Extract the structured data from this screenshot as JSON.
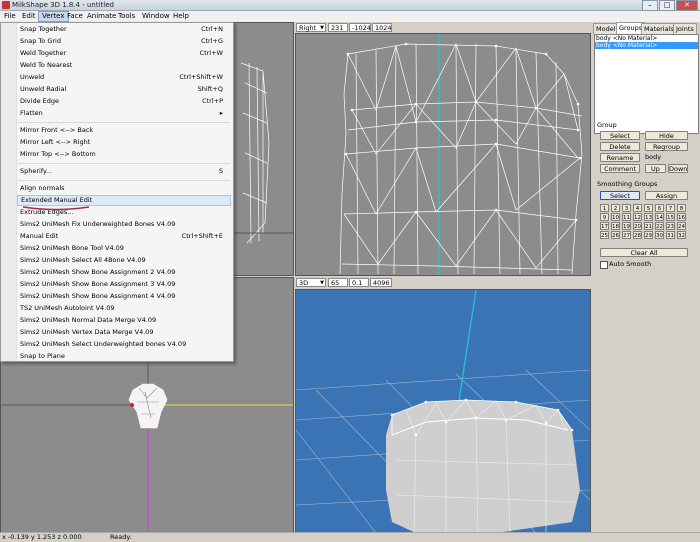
{
  "window": {
    "title": "MilkShape 3D 1.8.4 - untitled",
    "btn_min": "–",
    "btn_max": "□",
    "btn_close": "✕"
  },
  "menubar": [
    "File",
    "Edit",
    "Vertex",
    "Face",
    "Animate",
    "Tools",
    "Window",
    "Help"
  ],
  "vertex_menu": [
    {
      "label": "Snap Together",
      "shortcut": "Ctrl+N"
    },
    {
      "label": "Snap To Grid",
      "shortcut": "Ctrl+G"
    },
    {
      "label": "Weld Together",
      "shortcut": "Ctrl+W"
    },
    {
      "label": "Weld To Nearest",
      "shortcut": ""
    },
    {
      "label": "Unweld",
      "shortcut": "Ctrl+Shift+W"
    },
    {
      "label": "Unweld Radial",
      "shortcut": "Shift+Q"
    },
    {
      "label": "Divide Edge",
      "shortcut": "Ctrl+P"
    },
    {
      "label": "Flatten",
      "shortcut": "▸"
    },
    {
      "label": "Mirror Front <--> Back",
      "shortcut": ""
    },
    {
      "label": "Mirror Left <--> Right",
      "shortcut": ""
    },
    {
      "label": "Mirror Top <--> Bottom",
      "shortcut": ""
    },
    {
      "label": "Spherify...",
      "shortcut": "S"
    },
    {
      "label": "Align normals",
      "shortcut": ""
    },
    {
      "label": "Extended Manual Edit",
      "shortcut": ""
    },
    {
      "label": "Extrude Edges...",
      "shortcut": ""
    },
    {
      "label": "Sims2 UniMesh Fix Underweighted Bones V4.09",
      "shortcut": ""
    },
    {
      "label": "Manual Edit",
      "shortcut": "Ctrl+Shift+E"
    },
    {
      "label": "Sims2 UniMesh Bone Tool V4.09",
      "shortcut": ""
    },
    {
      "label": "Sims2 UniMesh Select All 4Bone V4.09",
      "shortcut": ""
    },
    {
      "label": "Sims2 UniMesh Show Bone Assignment 2 V4.09",
      "shortcut": ""
    },
    {
      "label": "Sims2 UniMesh Show Bone Assignment 3 V4.09",
      "shortcut": ""
    },
    {
      "label": "Sims2 UniMesh Show Bone Assignment 4 V4.09",
      "shortcut": ""
    },
    {
      "label": "TS2 UniMesh Autoloint V4.09",
      "shortcut": ""
    },
    {
      "label": "Sims2 UniMesh Normal Data Merge V4.09",
      "shortcut": ""
    },
    {
      "label": "Sims2 UniMesh Vertex Data Merge V4.09",
      "shortcut": ""
    },
    {
      "label": "Sims2 UniMesh Select Underweighted bones V4.09",
      "shortcut": ""
    },
    {
      "label": "Snap to Plane",
      "shortcut": ""
    }
  ],
  "viewport_tr": {
    "view": "Right",
    "v1": "231",
    "v2": "-1024",
    "v3": "1024"
  },
  "viewport_br": {
    "view": "3D",
    "v1": "65",
    "v2": "0.1",
    "v3": "4096"
  },
  "panel": {
    "tabs": [
      "Model",
      "Groups",
      "Materials",
      "Joints"
    ],
    "groups": [
      "body <No Material>",
      "body <No Material>"
    ],
    "group_label": "Group",
    "buttons": {
      "select": "Select",
      "hide": "Hide",
      "delete": "Delete",
      "regroup": "Regroup",
      "rename": "Rename",
      "comment": "Comment",
      "up": "Up",
      "down": "Down"
    },
    "rename_value": "body",
    "smoothing_label": "Smoothing Groups",
    "sg_select": "Select",
    "sg_assign": "Assign",
    "numbers": [
      "1",
      "2",
      "3",
      "4",
      "5",
      "6",
      "7",
      "8",
      "9",
      "10",
      "11",
      "12",
      "13",
      "14",
      "15",
      "16",
      "17",
      "18",
      "19",
      "20",
      "21",
      "22",
      "23",
      "24",
      "25",
      "26",
      "27",
      "28",
      "29",
      "30",
      "31",
      "32"
    ],
    "clear_all": "Clear All",
    "auto_smooth": "Auto Smooth"
  },
  "status": {
    "coords": "x -0.139 y 1.253 z 0.000",
    "text": "Ready."
  },
  "colors": {
    "viewport_3d_bg": "#3a74b4",
    "axis_cyan": "#20c8d8",
    "axis_yellow": "#e8e020",
    "axis_magenta": "#d040d0"
  }
}
